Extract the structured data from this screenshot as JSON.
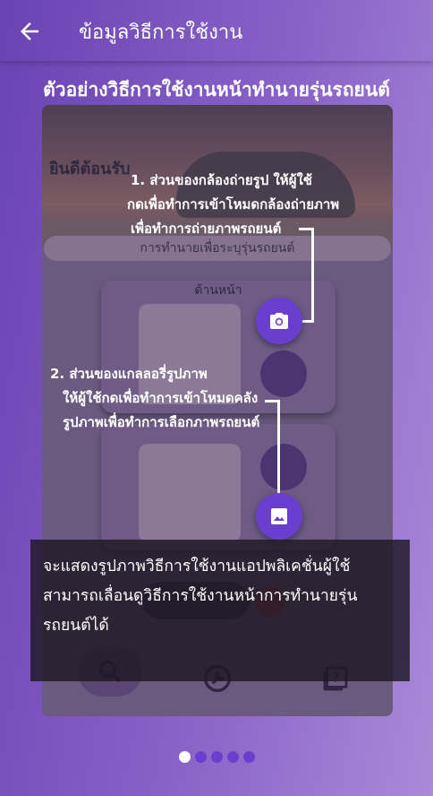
{
  "appbar": {
    "title": "ข้อมูลวิธีการใช้งาน",
    "back_icon": "arrow-back-icon"
  },
  "page_title": "ตัวอย่างวิธีการใช้งานหน้าทำนายรุ่นรถยนต์",
  "phone_screen": {
    "welcome": "ยินดีต้อนรับ",
    "predict_bar": "การทำนายเพื่อระบุรุ่นรถยนต์",
    "card_front_title": "ด้านหน้า",
    "nav_icons": [
      "search-icon",
      "wrench-icon",
      "help-icon"
    ]
  },
  "callouts": {
    "camera": {
      "line1": "1. ส่วนของกล้องถ่ายรูป ให้ผู้ใช้",
      "line2": "กดเพื่อทำการเข้าโหมดกล้องถ่ายภาพ",
      "line3": "เพื่อทำการถ่ายภาพรถยนต์",
      "icon": "camera-icon"
    },
    "gallery": {
      "line1": "2. ส่วนของแกลลอรี่รูปภาพ",
      "line2": "ให้ผู้ใช้กดเพื่อทำการเข้าโหมดคลัง",
      "line3": "รูปภาพเพื่อทำการเลือกภาพรถยนต์",
      "icon": "image-icon"
    }
  },
  "info_text": "จะแสดงรูปภาพวิธีการใช้งานแอปพลิเคชั่นผู้ใช้สามารถเลื่อนดูวิธีการใช้งานหน้าการทำนายรุ่นรถยนต์ได้",
  "pager": {
    "count": 5,
    "active_index": 0
  },
  "colors": {
    "accent": "#6a3fd0",
    "background_start": "#6a43b3",
    "background_end": "#a98ad8",
    "overlay": "#1e1824"
  }
}
